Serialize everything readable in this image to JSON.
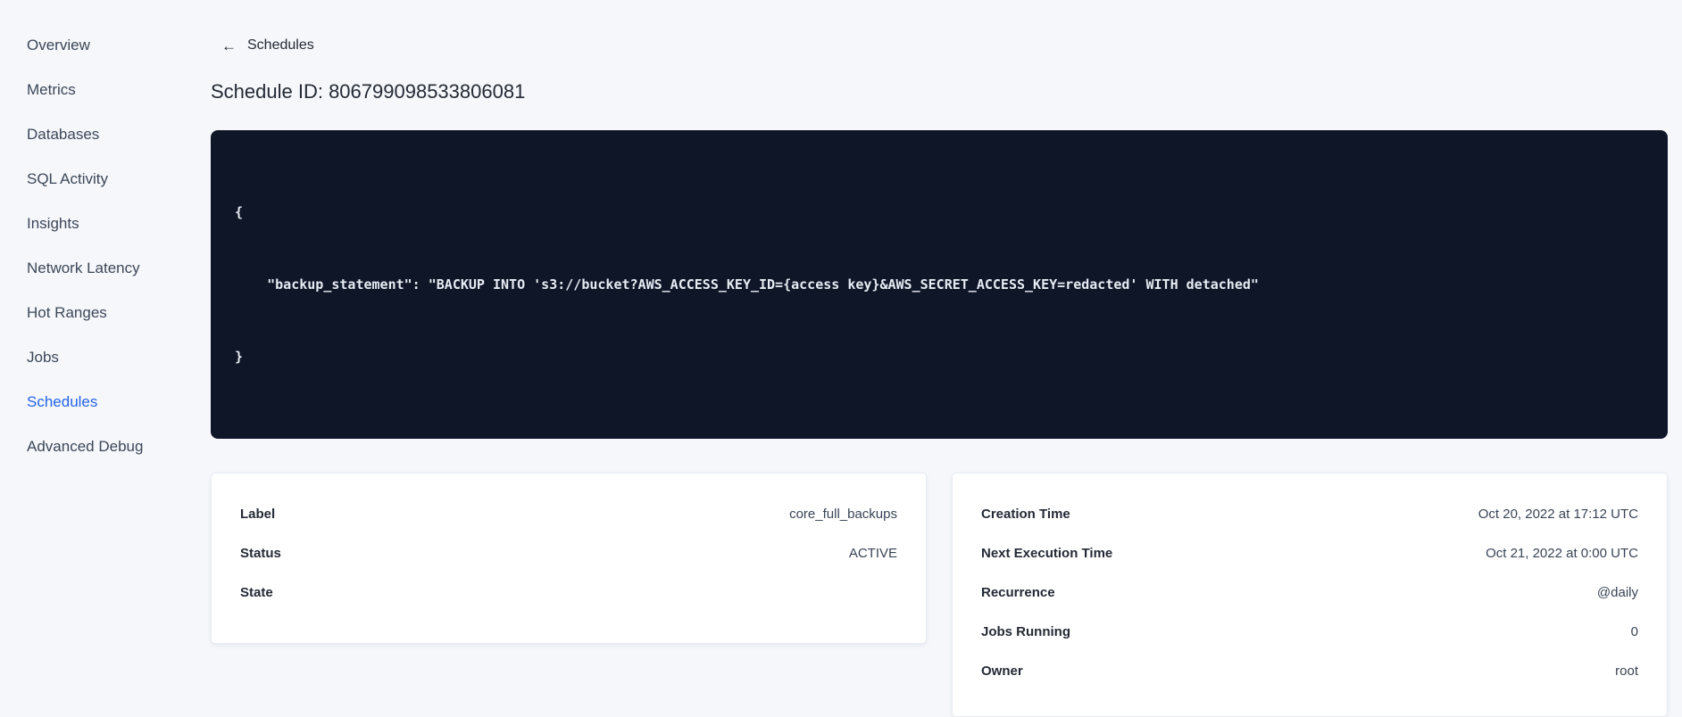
{
  "colors": {
    "page_background": "#f5f7fa",
    "active_link": "#2563eb",
    "code_background": "#0f1628",
    "code_text": "#e7ecf3",
    "card_background": "#ffffff"
  },
  "sidebar": {
    "items": [
      {
        "label": "Overview",
        "active": false
      },
      {
        "label": "Metrics",
        "active": false
      },
      {
        "label": "Databases",
        "active": false
      },
      {
        "label": "SQL Activity",
        "active": false
      },
      {
        "label": "Insights",
        "active": false
      },
      {
        "label": "Network Latency",
        "active": false
      },
      {
        "label": "Hot Ranges",
        "active": false
      },
      {
        "label": "Jobs",
        "active": false
      },
      {
        "label": "Schedules",
        "active": true
      },
      {
        "label": "Advanced Debug",
        "active": false
      }
    ]
  },
  "header": {
    "back_arrow": "←",
    "back_label": "Schedules",
    "title": "Schedule ID: 806799098533806081"
  },
  "code_block": {
    "lines": [
      "{",
      "    \"backup_statement\": \"BACKUP INTO 's3://bucket?AWS_ACCESS_KEY_ID={access key}&AWS_SECRET_ACCESS_KEY=redacted' WITH detached\"",
      "}"
    ]
  },
  "details_card": {
    "rows": [
      {
        "label": "Label",
        "value": "core_full_backups"
      },
      {
        "label": "Status",
        "value": "ACTIVE"
      },
      {
        "label": "State",
        "value": ""
      }
    ]
  },
  "schedule_card": {
    "rows": [
      {
        "label": "Creation Time",
        "value": "Oct 20, 2022 at 17:12 UTC"
      },
      {
        "label": "Next Execution Time",
        "value": "Oct 21, 2022 at 0:00 UTC"
      },
      {
        "label": "Recurrence",
        "value": "@daily"
      },
      {
        "label": "Jobs Running",
        "value": "0"
      },
      {
        "label": "Owner",
        "value": "root"
      }
    ]
  }
}
